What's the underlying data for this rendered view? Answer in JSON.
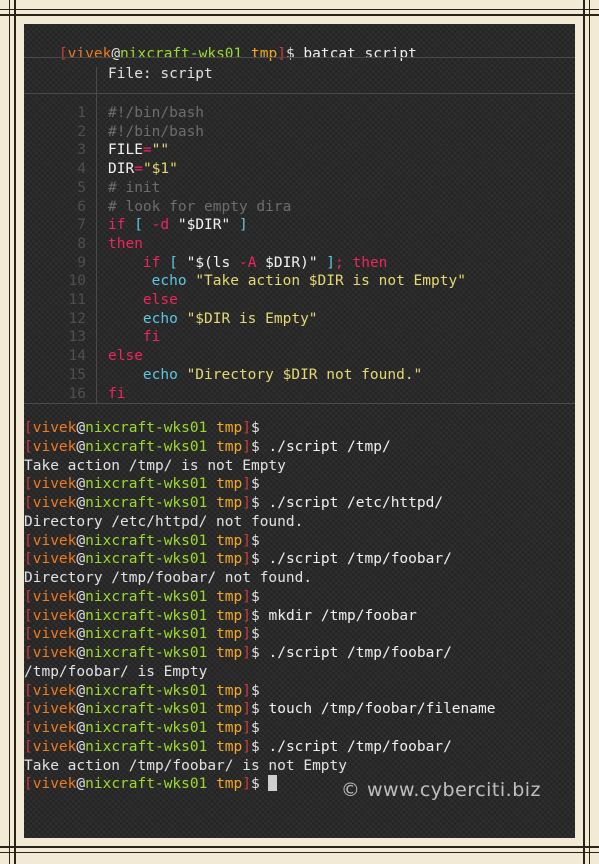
{
  "prompt": {
    "open_bracket": "[",
    "user": "vivek",
    "at": "@",
    "host": "nixcraft-wks01",
    "dir": "tmp",
    "close_bracket": "]",
    "dollar": "$"
  },
  "first_command": "batcat script",
  "bat": {
    "file_label": "File: script",
    "line_numbers": [
      "1",
      "2",
      "3",
      "4",
      "5",
      "6",
      "7",
      "8",
      "9",
      "10",
      "11",
      "12",
      "13",
      "14",
      "15",
      "16"
    ]
  },
  "session": [
    {
      "type": "prompt",
      "cmd": ""
    },
    {
      "type": "prompt",
      "cmd": "./script /tmp/"
    },
    {
      "type": "output",
      "text": "Take action /tmp/ is not Empty"
    },
    {
      "type": "prompt",
      "cmd": ""
    },
    {
      "type": "prompt",
      "cmd": "./script /etc/httpd/"
    },
    {
      "type": "output",
      "text": "Directory /etc/httpd/ not found."
    },
    {
      "type": "prompt",
      "cmd": ""
    },
    {
      "type": "prompt",
      "cmd": "./script /tmp/foobar/"
    },
    {
      "type": "output",
      "text": "Directory /tmp/foobar/ not found."
    },
    {
      "type": "prompt",
      "cmd": ""
    },
    {
      "type": "prompt",
      "cmd": "mkdir /tmp/foobar"
    },
    {
      "type": "prompt",
      "cmd": ""
    },
    {
      "type": "prompt",
      "cmd": "./script /tmp/foobar/"
    },
    {
      "type": "output",
      "text": "/tmp/foobar/ is Empty"
    },
    {
      "type": "prompt",
      "cmd": ""
    },
    {
      "type": "prompt",
      "cmd": "touch /tmp/foobar/filename"
    },
    {
      "type": "prompt",
      "cmd": ""
    },
    {
      "type": "prompt",
      "cmd": "./script /tmp/foobar/"
    },
    {
      "type": "output",
      "text": "Take action /tmp/foobar/ is not Empty"
    },
    {
      "type": "prompt",
      "cmd": ""
    }
  ],
  "code_lines": [
    [
      {
        "c": "comment",
        "t": "#!/bin/bash"
      }
    ],
    [
      {
        "c": "comment",
        "t": "#!/bin/bash"
      }
    ],
    [
      {
        "c": "plain",
        "t": "FILE"
      },
      {
        "c": "op",
        "t": "="
      },
      {
        "c": "str",
        "t": "\"\""
      }
    ],
    [
      {
        "c": "plain",
        "t": "DIR"
      },
      {
        "c": "op",
        "t": "="
      },
      {
        "c": "str",
        "t": "\"$1\""
      }
    ],
    [
      {
        "c": "comment",
        "t": "# init"
      }
    ],
    [
      {
        "c": "comment",
        "t": "# look for empty dira"
      }
    ],
    [
      {
        "c": "kw",
        "t": "if"
      },
      {
        "c": "plain",
        "t": " "
      },
      {
        "c": "builtin",
        "t": "["
      },
      {
        "c": "plain",
        "t": " "
      },
      {
        "c": "flag",
        "t": "-d"
      },
      {
        "c": "plain",
        "t": " \"$DIR\" "
      },
      {
        "c": "builtin",
        "t": "]"
      }
    ],
    [
      {
        "c": "kw",
        "t": "then"
      }
    ],
    [
      {
        "c": "plain",
        "t": "    "
      },
      {
        "c": "kw",
        "t": "if"
      },
      {
        "c": "plain",
        "t": " "
      },
      {
        "c": "builtin",
        "t": "["
      },
      {
        "c": "plain",
        "t": " \"$(ls "
      },
      {
        "c": "flag",
        "t": "-A"
      },
      {
        "c": "plain",
        "t": " $DIR)\" "
      },
      {
        "c": "builtin",
        "t": "]"
      },
      {
        "c": "op",
        "t": ";"
      },
      {
        "c": "plain",
        "t": " "
      },
      {
        "c": "kw",
        "t": "then"
      }
    ],
    [
      {
        "c": "plain",
        "t": "     "
      },
      {
        "c": "builtin",
        "t": "echo"
      },
      {
        "c": "plain",
        "t": " "
      },
      {
        "c": "str",
        "t": "\"Take action $DIR is not Empty\""
      }
    ],
    [
      {
        "c": "plain",
        "t": "    "
      },
      {
        "c": "kw",
        "t": "else"
      }
    ],
    [
      {
        "c": "plain",
        "t": "    "
      },
      {
        "c": "builtin",
        "t": "echo"
      },
      {
        "c": "plain",
        "t": " "
      },
      {
        "c": "str",
        "t": "\"$DIR is Empty\""
      }
    ],
    [
      {
        "c": "plain",
        "t": "    "
      },
      {
        "c": "kw",
        "t": "fi"
      }
    ],
    [
      {
        "c": "kw",
        "t": "else"
      }
    ],
    [
      {
        "c": "plain",
        "t": "    "
      },
      {
        "c": "builtin",
        "t": "echo"
      },
      {
        "c": "plain",
        "t": " "
      },
      {
        "c": "str",
        "t": "\"Directory $DIR not found.\""
      }
    ],
    [
      {
        "c": "kw",
        "t": "fi"
      }
    ]
  ],
  "watermark": "© www.cyberciti.biz",
  "colors": {
    "background": "#262626",
    "prompt_user": "#f07a1e",
    "prompt_host": "#9bdc2a",
    "prompt_dir": "#f3a928",
    "prompt_bracket": "#d03a3a",
    "keyword": "#f0245f",
    "string": "#e6d873",
    "builtin": "#5bc8e6",
    "comment": "#6d6d6d"
  }
}
